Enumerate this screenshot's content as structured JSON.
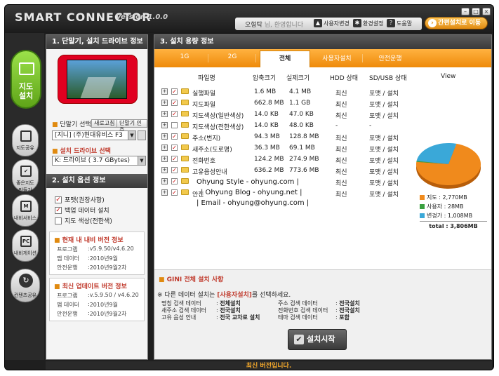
{
  "app": {
    "title": "SMART CONNECTOR",
    "version": "Version 1.0.0"
  },
  "header": {
    "user_name": "오형탁",
    "greeting": "님, 환영합니다",
    "user_change": "사용자변경",
    "env_settings": "환경설정",
    "help": "도움말",
    "quick_install": "간편설치로 이동"
  },
  "nav": {
    "main": "지도\n설치",
    "items": [
      "지도공유",
      "좋은지도\n만들기",
      "내비서비스",
      "내비게이션"
    ],
    "content": "컨텐츠공유"
  },
  "left_panel": {
    "section1_title": "1. 단말기, 설치 드라이브 정보",
    "device_select_label": "단말기 선택",
    "refresh_btn": "새로고침",
    "auth_btn": "단말기 인증",
    "device_value": "[지니] (주)현대유비스 F3",
    "drive_label": "설치 드라이브 선택",
    "drive_value": "K: 드라이브 ( 3.7 GBytes)",
    "section2_title": "2. 설치 옵션 정보",
    "options": [
      {
        "label": "포맷(권장사항)",
        "checked": true
      },
      {
        "label": "백업 데이터 설치",
        "checked": true
      },
      {
        "label": "지도 색상(전한색)",
        "checked": false
      }
    ],
    "current_title": "현재 내 내비 버전 정보",
    "current": [
      {
        "k": "프로그램",
        "v": "v5.9.50/v4.6.20"
      },
      {
        "k": "맵 데이터",
        "v": "2010년9월"
      },
      {
        "k": "안전운행",
        "v": "2010년9월2차"
      }
    ],
    "latest_title": "최신 업데이트 버전 정보",
    "latest": [
      {
        "k": "프로그램",
        "v": "v.5.9.50 / v4.6.20"
      },
      {
        "k": "맵 데이터",
        "v": "2010년9월"
      },
      {
        "k": "안전운행",
        "v": "2010년9월2차"
      }
    ]
  },
  "main": {
    "title": "3. 설치 용량 정보",
    "tabs": [
      "1G",
      "2G",
      "전체",
      "사용자설치",
      "안전운행"
    ],
    "columns": [
      "파일명",
      "압축크기",
      "실제크기",
      "HDD 상태",
      "SD/USB 상태",
      "View"
    ],
    "rows": [
      {
        "name": "실행파일",
        "comp": "1.6 MB",
        "real": "4.1 MB",
        "hdd": "최신",
        "sd": "포맷 / 설치",
        "checked": true
      },
      {
        "name": "지도파일",
        "comp": "662.8 MB",
        "real": "1.1 GB",
        "hdd": "최신",
        "sd": "포맷 / 설치",
        "checked": true
      },
      {
        "name": "지도색상(일반색상)",
        "comp": "14.0 KB",
        "real": "47.0 KB",
        "hdd": "최신",
        "sd": "포맷 / 설치",
        "checked": true
      },
      {
        "name": "지도색상(전한색상)",
        "comp": "14.0 KB",
        "real": "48.0 KB",
        "hdd": "-",
        "sd": "-",
        "checked": false
      },
      {
        "name": "주소(번지)",
        "comp": "94.3 MB",
        "real": "128.8 MB",
        "hdd": "최신",
        "sd": "포맷 / 설치",
        "checked": true
      },
      {
        "name": "새주소(도로명)",
        "comp": "36.3 MB",
        "real": "69.1 MB",
        "hdd": "최신",
        "sd": "포맷 / 설치",
        "checked": true
      },
      {
        "name": "전화번호",
        "comp": "124.2 MB",
        "real": "274.9 MB",
        "hdd": "최신",
        "sd": "포맷 / 설치",
        "checked": true
      },
      {
        "name": "고유음성안내",
        "comp": "636.2 MB",
        "real": "773.6 MB",
        "hdd": "최신",
        "sd": "포맷 / 설치",
        "checked": true
      },
      {
        "name": "",
        "comp": "",
        "real": "",
        "hdd": "최신",
        "sd": "포맷 / 설치",
        "checked": true
      },
      {
        "name": "안전",
        "comp": "",
        "real": "",
        "hdd": "최신",
        "sd": "포맷 / 설치",
        "checked": true
      }
    ],
    "watermark1": "Ohyung Style - ohyung.com |",
    "watermark2": "| Ohyung Blog - ohyung.net |",
    "watermark3": "| Email - ohyung@ohyung.com |",
    "legend": [
      {
        "label": "지도 : 2,770MB",
        "color": "#f08a1c"
      },
      {
        "label": "사용자 : 28MB",
        "color": "#3aa040"
      },
      {
        "label": "변경가 : 1,008MB",
        "color": "#3aa8d8"
      }
    ],
    "legend_total": "total : 3,806MB",
    "chart_data": {
      "type": "pie",
      "categories": [
        "지도",
        "사용자",
        "변경가"
      ],
      "values": [
        2770,
        28,
        1008
      ]
    }
  },
  "gini": {
    "title": "GINI 전체 설치 사항",
    "note_prefix": "※ 다른 데이터 설치는 ",
    "note_hl": "[사용자설치]",
    "note_suffix": "를 선택하세요.",
    "items": [
      {
        "k": "명칭 검색 데이터",
        "v": "전체설치"
      },
      {
        "k": "주소 검색 데이터",
        "v": "전국설치"
      },
      {
        "k": "새주소 검색 데이터",
        "v": "전국설치"
      },
      {
        "k": "전화번호 검색 데이터",
        "v": "전국설치"
      },
      {
        "k": "고유 음성 안내",
        "v": "전국 교차로 설치"
      },
      {
        "k": "테마 검색 데이터",
        "v": "포함"
      }
    ],
    "install_btn": "설치시작"
  },
  "status": "최신 버전입니다."
}
